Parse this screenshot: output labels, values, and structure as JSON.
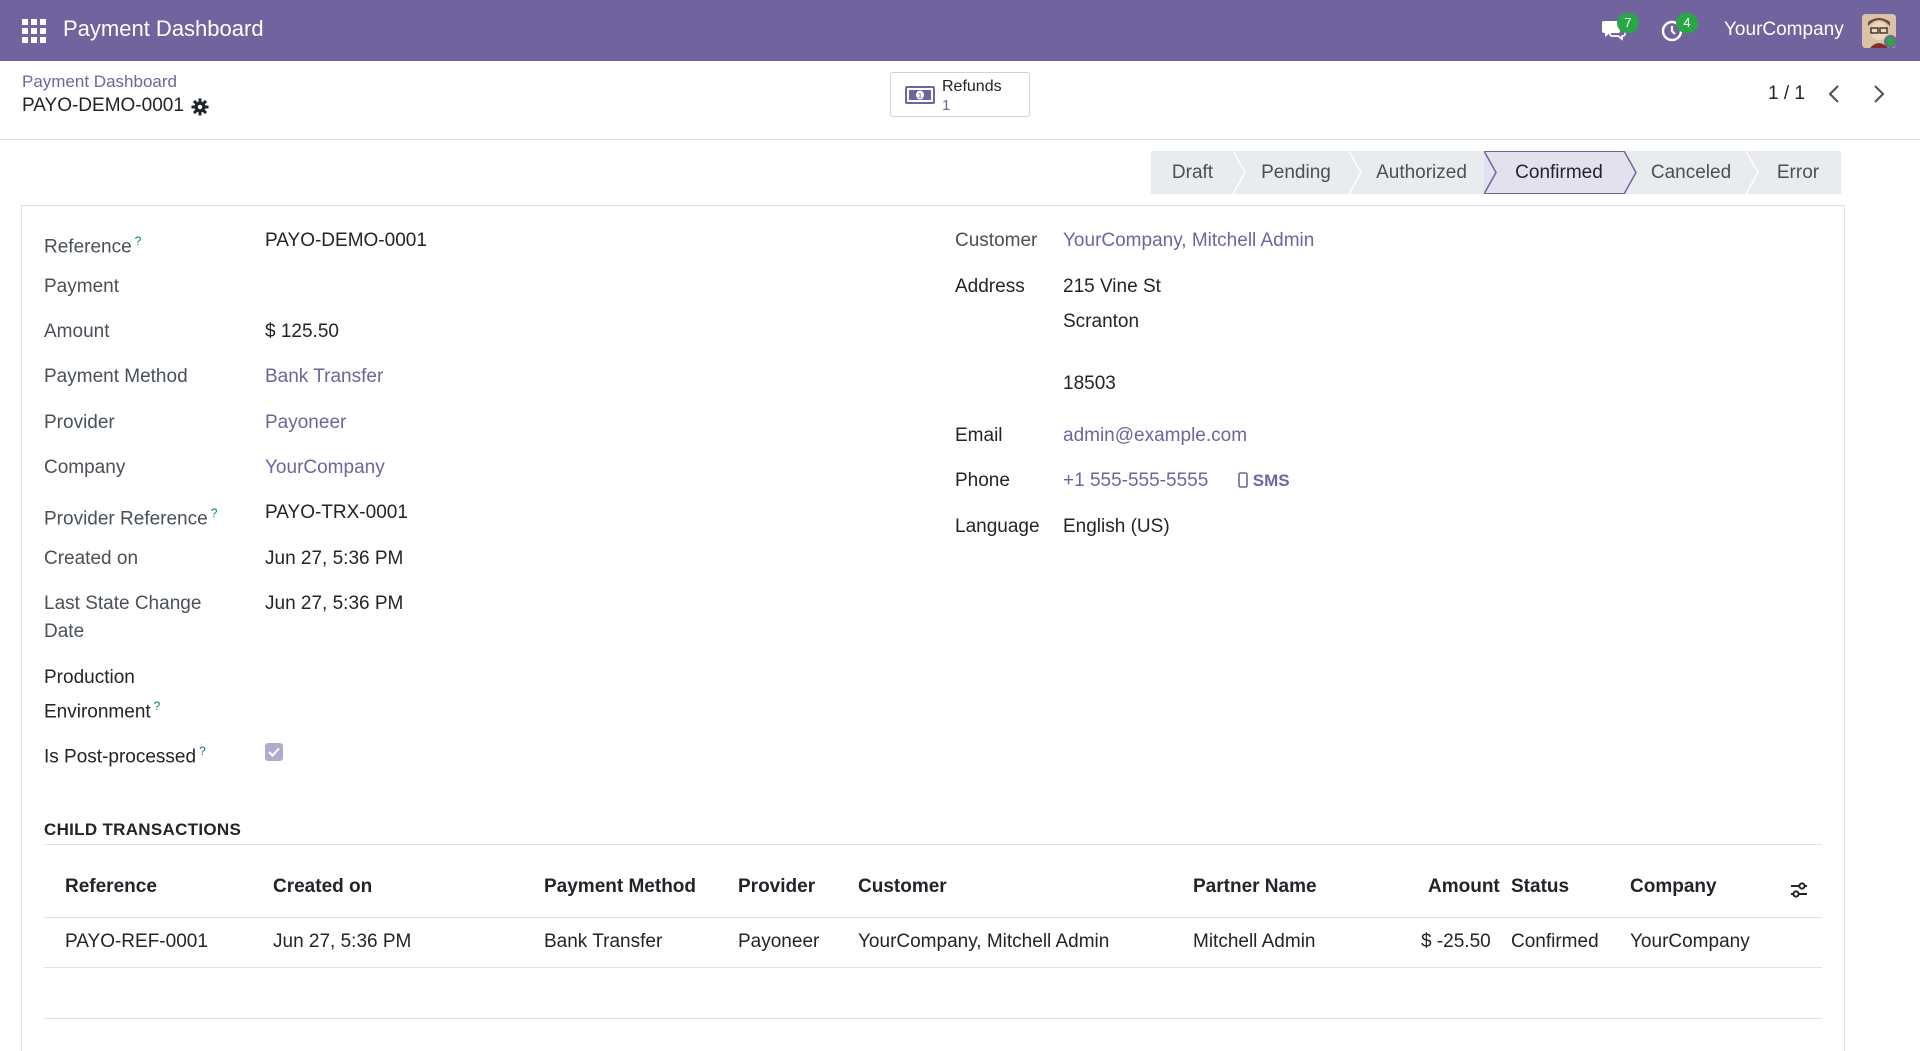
{
  "navbar": {
    "app_title": "Payment Dashboard",
    "messages_count": "7",
    "activities_count": "4",
    "company": "YourCompany",
    "accent_color": "#71639e"
  },
  "control": {
    "breadcrumb": "Payment Dashboard",
    "record_name": "PAYO-DEMO-0001",
    "smart_button": {
      "label": "Refunds",
      "value": "1"
    },
    "pager": "1 / 1"
  },
  "statusbar": {
    "stages": [
      "Draft",
      "Pending",
      "Authorized",
      "Confirmed",
      "Canceled",
      "Error"
    ],
    "active": "Confirmed"
  },
  "left_fields": {
    "reference_label": "Reference",
    "reference_value": "PAYO-DEMO-0001",
    "payment_label": "Payment",
    "amount_label": "Amount",
    "amount_value": "$ 125.50",
    "method_label": "Payment Method",
    "method_value": "Bank Transfer",
    "provider_label": "Provider",
    "provider_value": "Payoneer",
    "company_label": "Company",
    "company_value": "YourCompany",
    "provider_ref_label": "Provider Reference",
    "provider_ref_value": "PAYO-TRX-0001",
    "created_label": "Created on",
    "created_value": "Jun 27, 5:36 PM",
    "last_state_label_1": "Last State Change",
    "last_state_label_2": "Date",
    "last_state_value": "Jun 27, 5:36 PM",
    "production_label_1": "Production",
    "production_label_2": "Environment",
    "post_processed_label": "Is Post-processed",
    "post_processed_checked": true,
    "help_mark": "?"
  },
  "right_fields": {
    "customer_label": "Customer",
    "customer_value": "YourCompany, Mitchell Admin",
    "address_label": "Address",
    "address_line1": "215 Vine St",
    "address_line2": "Scranton",
    "address_zip": "18503",
    "email_label": "Email",
    "email_value": "admin@example.com",
    "phone_label": "Phone",
    "phone_value": "+1 555-555-5555",
    "sms_label": "SMS",
    "language_label": "Language",
    "language_value": "English (US)"
  },
  "child_transactions": {
    "title": "CHILD TRANSACTIONS",
    "columns": [
      "Reference",
      "Created on",
      "Payment Method",
      "Provider",
      "Customer",
      "Partner Name",
      "Amount",
      "Status",
      "Company"
    ],
    "rows": [
      [
        "PAYO-REF-0001",
        "Jun 27, 5:36 PM",
        "Bank Transfer",
        "Payoneer",
        "YourCompany, Mitchell Admin",
        "Mitchell Admin",
        "$ -25.50",
        "Confirmed",
        "YourCompany"
      ]
    ]
  }
}
